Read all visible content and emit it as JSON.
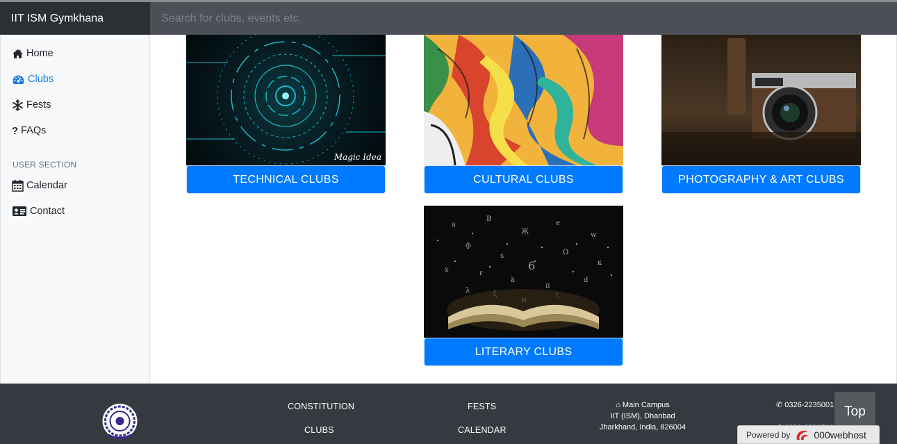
{
  "navbar": {
    "brand": "IIT ISM Gymkhana",
    "search_placeholder": "Search for clubs, events etc."
  },
  "sidebar": {
    "items": [
      {
        "label": "Home",
        "icon": "home-icon"
      },
      {
        "label": "Clubs",
        "icon": "dashboard-icon",
        "active": true
      },
      {
        "label": "Fests",
        "icon": "snowflake-icon"
      },
      {
        "label": "FAQs",
        "icon": "question-icon"
      }
    ],
    "section_heading": "USER SECTION",
    "user_items": [
      {
        "label": "Calendar",
        "icon": "calendar-icon"
      },
      {
        "label": "Contact",
        "icon": "id-card-icon"
      }
    ]
  },
  "cards": [
    {
      "label": "TECHNICAL CLUBS",
      "image": "technical-clubs-image",
      "watermark": "Magic Idea"
    },
    {
      "label": "CULTURAL CLUBS",
      "image": "cultural-clubs-image"
    },
    {
      "label": "PHOTOGRAPHY & ART CLUBS",
      "image": "photography-art-clubs-image"
    },
    {
      "label": "LITERARY CLUBS",
      "image": "literary-clubs-image"
    }
  ],
  "footer": {
    "links": [
      "CONSTITUTION",
      "FESTS",
      "CLUBS",
      "CALENDAR"
    ],
    "address": {
      "line1": "Main Campus",
      "line2": "IIT (ISM), Dhanbad",
      "line3": "Jharkhand, India, 826004"
    },
    "phone": "0326-2235001",
    "fax": "0326-2296563",
    "top_label": "Top",
    "powered_by": "Powered by",
    "host": "000webhost"
  },
  "colors": {
    "accent": "#007bff",
    "navbar": "#343a40",
    "active": "#1a7be6"
  }
}
